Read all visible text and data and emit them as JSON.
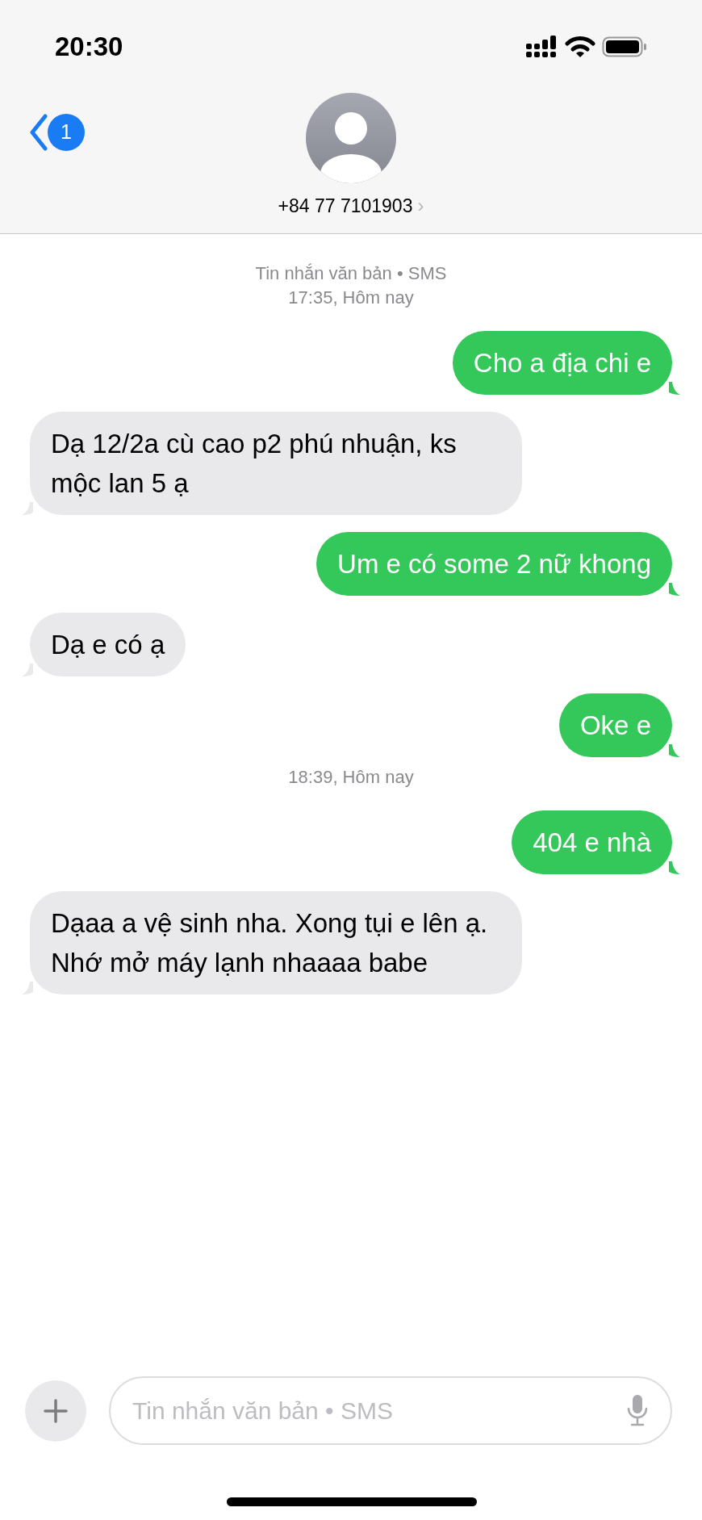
{
  "status_bar": {
    "time": "20:30"
  },
  "header": {
    "back_badge": "1",
    "contact": "+84 77 7101903",
    "chevron": "›"
  },
  "conversation": [
    {
      "kind": "stamp",
      "lines": [
        "Tin nhắn văn bản • SMS",
        "17:35, Hôm nay"
      ]
    },
    {
      "kind": "message",
      "sent": true,
      "text": "Cho a địa chi e"
    },
    {
      "kind": "message",
      "sent": false,
      "text": "Dạ 12/2a cù cao p2 phú nhuận, ks mộc lan 5 ạ"
    },
    {
      "kind": "message",
      "sent": true,
      "text": "Um e có some 2 nữ khong"
    },
    {
      "kind": "message",
      "sent": false,
      "text": "Dạ e có ạ"
    },
    {
      "kind": "message",
      "sent": true,
      "text": "Oke e"
    },
    {
      "kind": "stamp",
      "lines": [
        "18:39, Hôm nay"
      ]
    },
    {
      "kind": "message",
      "sent": true,
      "text": "404 e nhà"
    },
    {
      "kind": "message",
      "sent": false,
      "text": "Dạaa a vệ sinh nha. Xong tụi e lên ạ. Nhớ mở máy lạnh nhaaaa babe"
    }
  ],
  "composer": {
    "placeholder": "Tin nhắn văn bản • SMS"
  }
}
